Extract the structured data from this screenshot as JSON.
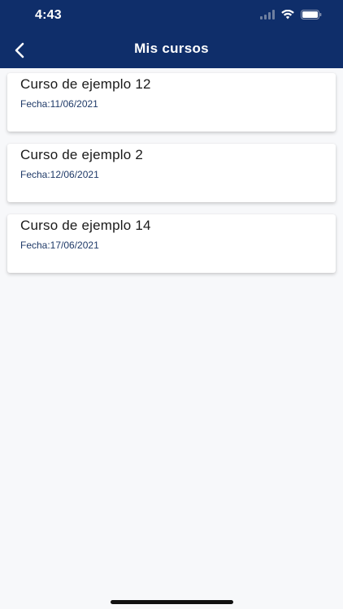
{
  "status_bar": {
    "time": "4:43"
  },
  "header": {
    "title": "Mis cursos",
    "back_icon": "chevron-left-icon"
  },
  "courses": [
    {
      "title": "Curso de ejemplo 12",
      "date": "Fecha:11/06/2021"
    },
    {
      "title": "Curso de ejemplo 2",
      "date": "Fecha:12/06/2021"
    },
    {
      "title": "Curso de ejemplo 14",
      "date": "Fecha:17/06/2021"
    }
  ],
  "colors": {
    "header_bg": "#0f2e6a",
    "page_bg": "#f7f8fa",
    "date_text": "#1f3a68"
  }
}
